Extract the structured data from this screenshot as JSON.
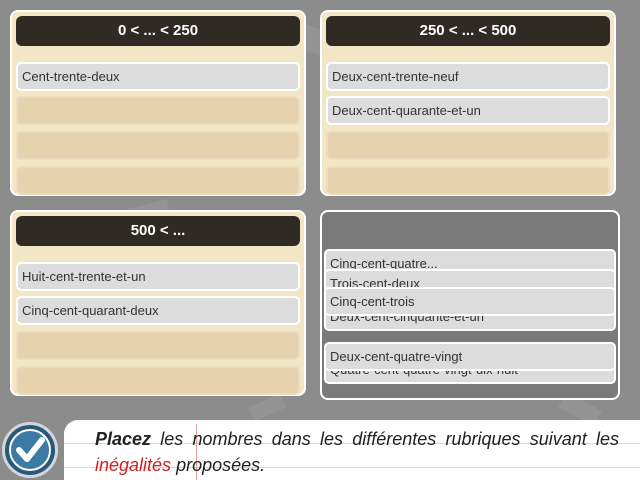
{
  "panels": [
    {
      "header": "0 < ... < 250",
      "cards": [
        "Cent-trente-deux"
      ]
    },
    {
      "header": "250 < ... < 500",
      "cards": [
        "Deux-cent-trente-neuf",
        "Deux-cent-quarante-et-un"
      ]
    },
    {
      "header": "500 < ...",
      "cards": [
        "Huit-cent-trente-et-un",
        "Cinq-cent-quarant-deux"
      ]
    }
  ],
  "pool": {
    "cards_partial": [
      "Cinq-cent-quatre...",
      "Trois-cent-deux",
      "Deux-cent-cinquante-et-un",
      "Quatre-cent-quatre-vingt-dix-huit"
    ],
    "cards_visible": [
      "Cinq-cent-trois",
      "Deux-cent-quatre-vingt"
    ]
  },
  "instruction": {
    "bold": "Placez",
    "part1": " les nombres dans les différentes rubriques suivant les ",
    "red": "inégalités",
    "part2": " proposées."
  },
  "colors": {
    "header": "#2f2a24",
    "panel": "#f3e6c6",
    "slot": "#e6d3ae",
    "card": "#dcdcdc",
    "accent_red": "#cc2222",
    "check_button": "#2a5877"
  },
  "icons": {
    "validate": "check-icon"
  }
}
